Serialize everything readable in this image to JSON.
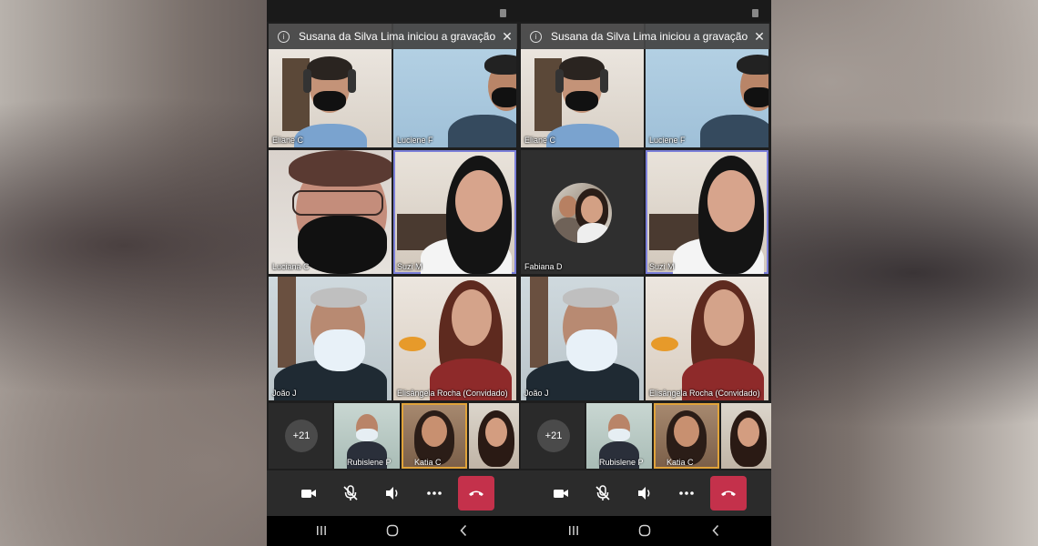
{
  "banner": {
    "text": "Susana da Silva Lima iniciou a gravação",
    "info_icon": "i",
    "close_icon": "✕"
  },
  "participants": {
    "eliane": "Eliane C",
    "luciene": "Luciene F",
    "luciana": "Luciana C",
    "fabiana": "Fabiana D",
    "suzi": "Suzi M",
    "joao": "João J",
    "elisangela": "Elisângela Rocha (Convidado)",
    "rubislene": "Rubislene P",
    "katia": "Katia C"
  },
  "overflow": {
    "count": "+21"
  },
  "controls": {
    "camera_icon": "camera-icon",
    "mic_icon": "mic-off-icon",
    "speaker_icon": "speaker-icon",
    "more_icon": "more-icon",
    "hangup_icon": "hangup-icon"
  },
  "navbar": {
    "recents": "|||",
    "home": "○",
    "back": "‹"
  },
  "colors": {
    "hangup": "#c4314b",
    "active_border": "#7b7fd9",
    "banner_bg": "#464646"
  }
}
